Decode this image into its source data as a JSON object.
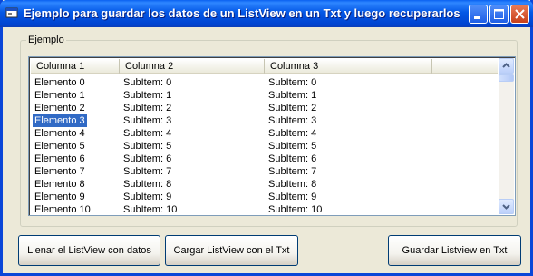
{
  "window": {
    "title": "Ejemplo para guardar los datos de un ListView en un Txt y luego recuperarlos"
  },
  "group": {
    "label": "Ejemplo"
  },
  "listview": {
    "columns": [
      "Columna 1",
      "Columna 2",
      "Columna 3"
    ],
    "rows": [
      [
        "Elemento 0",
        "SubItem: 0",
        "SubItem: 0"
      ],
      [
        "Elemento 1",
        "SubItem: 1",
        "SubItem: 1"
      ],
      [
        "Elemento 2",
        "SubItem: 2",
        "SubItem: 2"
      ],
      [
        "Elemento 3",
        "SubItem: 3",
        "SubItem: 3"
      ],
      [
        "Elemento 4",
        "SubItem: 4",
        "SubItem: 4"
      ],
      [
        "Elemento 5",
        "SubItem: 5",
        "SubItem: 5"
      ],
      [
        "Elemento 6",
        "SubItem: 6",
        "SubItem: 6"
      ],
      [
        "Elemento 7",
        "SubItem: 7",
        "SubItem: 7"
      ],
      [
        "Elemento 8",
        "SubItem: 8",
        "SubItem: 8"
      ],
      [
        "Elemento 9",
        "SubItem: 9",
        "SubItem: 9"
      ],
      [
        "Elemento 10",
        "SubItem: 10",
        "SubItem: 10"
      ]
    ],
    "selected_row": 3
  },
  "buttons": {
    "fill": "Llenar el ListView con datos",
    "load": "Cargar ListView con el Txt",
    "save": "Guardar Listview en Txt"
  },
  "colors": {
    "titlebar": "#0458E6",
    "face": "#ECE9D8",
    "selection": "#316AC5"
  }
}
